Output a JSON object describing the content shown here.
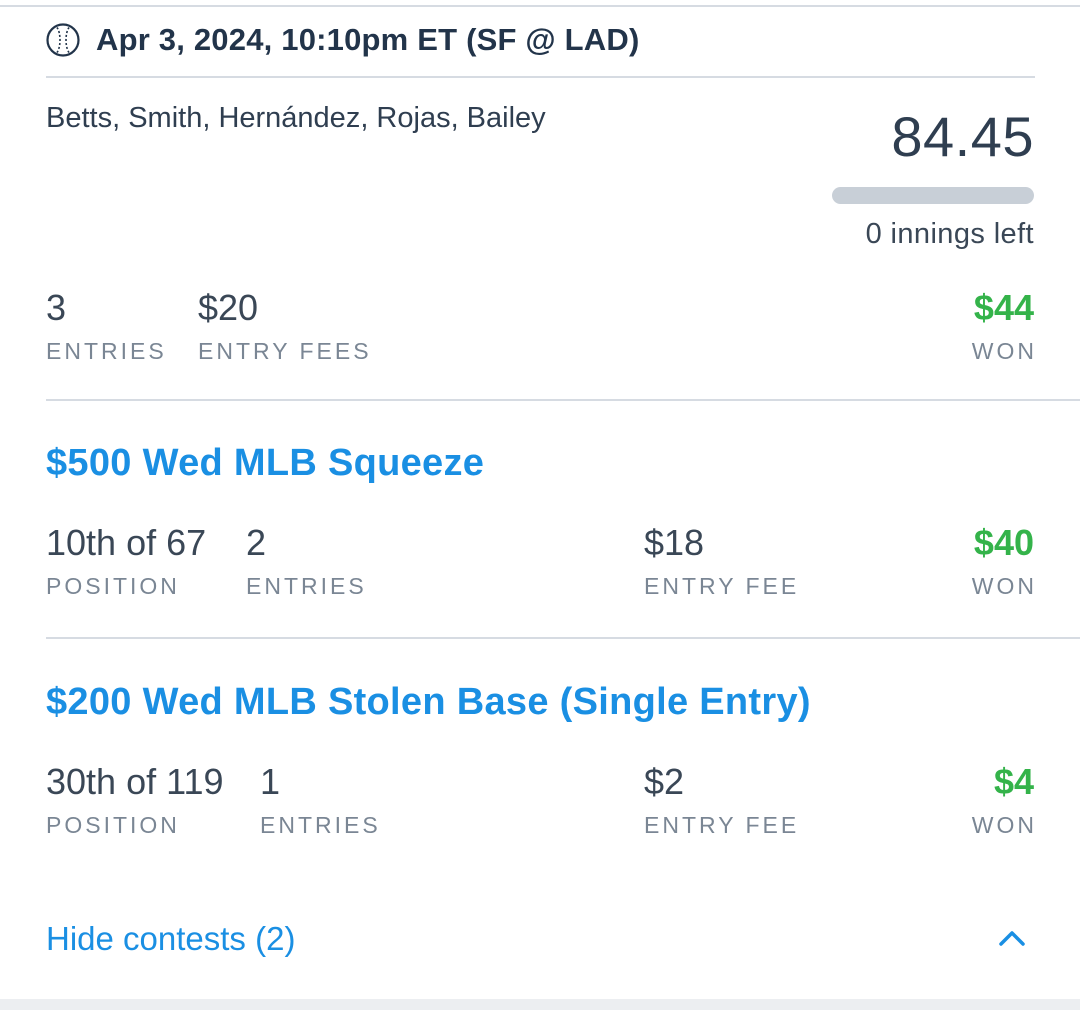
{
  "header": {
    "title": "Apr 3, 2024, 10:10pm ET (SF @ LAD)",
    "icon": "baseball-icon"
  },
  "lineup": {
    "players": "Betts, Smith, Hernández, Rojas, Bailey",
    "score": "84.45",
    "progress_fraction": 0,
    "innings_left": "0 innings left"
  },
  "summary": {
    "entries_value": "3",
    "entries_label": "ENTRIES",
    "fees_value": "$20",
    "fees_label": "ENTRY FEES",
    "won_value": "$44",
    "won_label": "WON"
  },
  "contests": [
    {
      "title": "$500 Wed MLB Squeeze",
      "position_value": "10th of 67",
      "position_label": "POSITION",
      "entries_value": "2",
      "entries_label": "ENTRIES",
      "fee_value": "$18",
      "fee_label": "ENTRY FEE",
      "won_value": "$40",
      "won_label": "WON"
    },
    {
      "title": "$200 Wed MLB Stolen Base (Single Entry)",
      "position_value": "30th of 119",
      "position_label": "POSITION",
      "entries_value": "1",
      "entries_label": "ENTRIES",
      "fee_value": "$2",
      "fee_label": "ENTRY FEE",
      "won_value": "$4",
      "won_label": "WON"
    }
  ],
  "footer": {
    "hide_label": "Hide contests (2)",
    "chevron_icon": "chevron-up-icon"
  },
  "colors": {
    "accent": "#1a8fe3",
    "won": "#34b34a",
    "text": "#2f3e50"
  }
}
